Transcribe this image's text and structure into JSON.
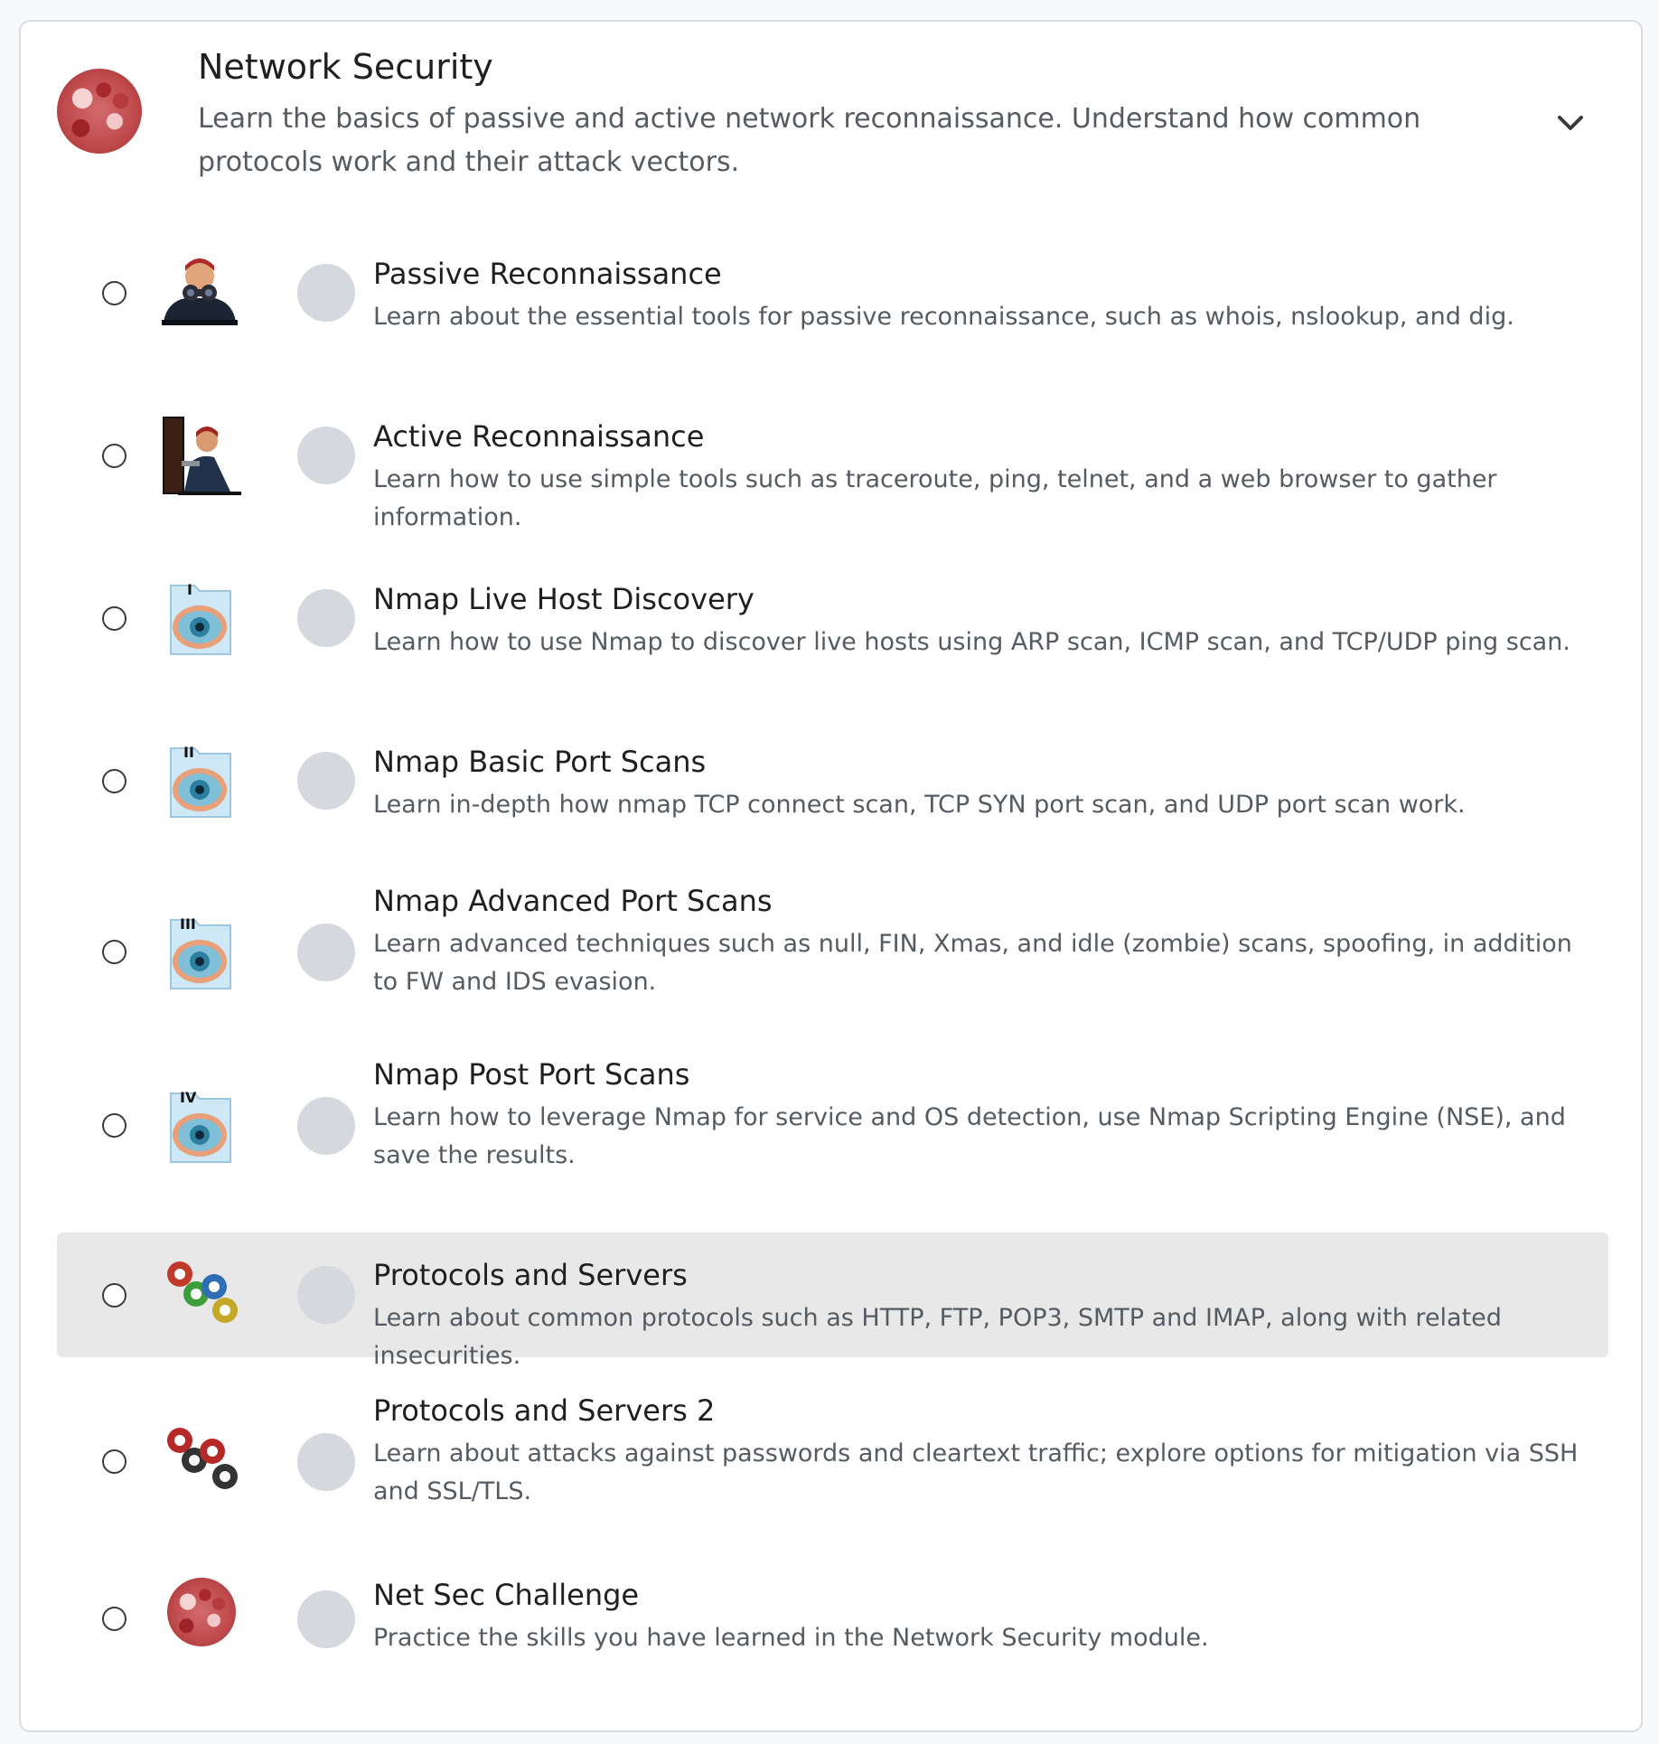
{
  "module": {
    "title": "Network Security",
    "description": "Learn the basics of passive and active network reconnaissance. Understand how common protocols work and their attack vectors.",
    "icon": "network-globe-icon",
    "expand_icon": "chevron-down-icon"
  },
  "rooms": [
    {
      "title": "Passive Reconnaissance",
      "description": "Learn about the essential tools for passive reconnaissance, such as whois, nslookup, and dig.",
      "icon": "binoculars-hacker-icon",
      "selected": false
    },
    {
      "title": "Active Reconnaissance",
      "description": "Learn how to use simple tools such as traceroute, ping, telnet, and a web browser to gather information.",
      "icon": "door-peeking-hacker-icon",
      "selected": false
    },
    {
      "title": "Nmap Live Host Discovery",
      "description": "Learn how to use Nmap to discover live hosts using ARP scan, ICMP scan, and TCP/UDP ping scan.",
      "icon": "nmap-eye-icon",
      "badge": "I",
      "selected": false
    },
    {
      "title": "Nmap Basic Port Scans",
      "description": "Learn in-depth how nmap TCP connect scan, TCP SYN port scan, and UDP port scan work.",
      "icon": "nmap-eye-icon",
      "badge": "II",
      "selected": false
    },
    {
      "title": "Nmap Advanced Port Scans",
      "description": "Learn advanced techniques such as null, FIN, Xmas, and idle (zombie) scans, spoofing, in addition to FW and IDS evasion.",
      "icon": "nmap-eye-icon",
      "badge": "III",
      "selected": false
    },
    {
      "title": "Nmap Post Port Scans",
      "description": "Learn how to leverage Nmap for service and OS detection, use Nmap Scripting Engine (NSE), and save the results.",
      "icon": "nmap-eye-icon",
      "badge": "IV",
      "selected": false
    },
    {
      "title": "Protocols and Servers",
      "description": "Learn about common protocols such as HTTP, FTP, POP3, SMTP and IMAP, along with related insecurities.",
      "icon": "colored-gears-icon",
      "selected": false,
      "highlighted": true
    },
    {
      "title": "Protocols and Servers 2",
      "description": "Learn about attacks against passwords and cleartext traffic; explore options for mitigation via SSH and SSL/TLS.",
      "icon": "dark-gears-icon",
      "selected": false
    },
    {
      "title": "Net Sec Challenge",
      "description": "Practice the skills you have learned in the Network Security module.",
      "icon": "network-globe-icon",
      "selected": false
    }
  ],
  "colors": {
    "highlight_row": "#e8e8e8",
    "progress_dot": "#d5d9de",
    "text_secondary": "#555b61"
  }
}
